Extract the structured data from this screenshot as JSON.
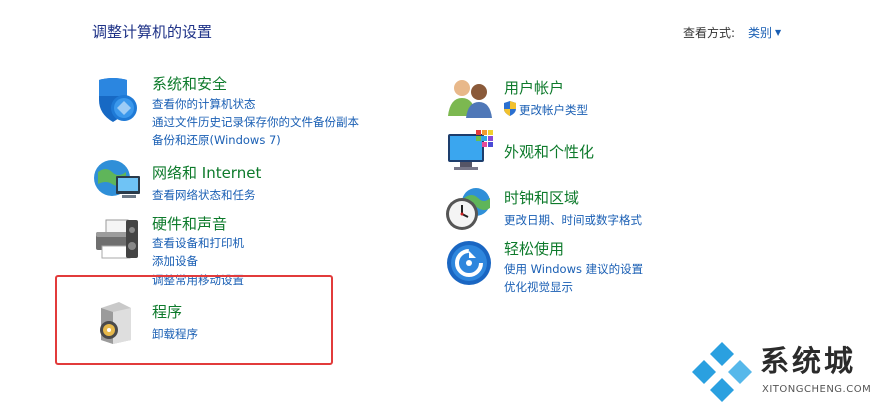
{
  "header": {
    "title": "调整计算机的设置",
    "view_by_label": "查看方式:",
    "view_by_value": "类别"
  },
  "categories": {
    "system_security": {
      "icon": "shield-icon",
      "title": "系统和安全",
      "links": [
        "查看你的计算机状态",
        "通过文件历史记录保存你的文件备份副本",
        "备份和还原(Windows 7)"
      ]
    },
    "network": {
      "icon": "network-globe-icon",
      "title": "网络和 Internet",
      "links": [
        "查看网络状态和任务"
      ]
    },
    "hardware": {
      "icon": "printer-icon",
      "title": "硬件和声音",
      "links": [
        "查看设备和打印机",
        "添加设备",
        "调整常用移动设置"
      ]
    },
    "programs": {
      "icon": "programs-disc-icon",
      "title": "程序",
      "links": [
        "卸载程序"
      ]
    },
    "user_accounts": {
      "icon": "users-icon",
      "title": "用户帐户",
      "links": [
        "更改帐户类型"
      ]
    },
    "appearance": {
      "icon": "monitor-palette-icon",
      "title": "外观和个性化",
      "links": []
    },
    "clock_region": {
      "icon": "clock-globe-icon",
      "title": "时钟和区域",
      "links": [
        "更改日期、时间或数字格式"
      ]
    },
    "ease_of_access": {
      "icon": "ease-of-access-icon",
      "title": "轻松使用",
      "links": [
        "使用 Windows 建议的设置",
        "优化视觉显示"
      ]
    }
  },
  "watermark": {
    "text": "系统城",
    "url": "XITONGCHENG.COM"
  },
  "colors": {
    "title_blue": "#1e3287",
    "link_blue": "#1a5fb4",
    "category_green": "#0d7a2b",
    "highlight_red": "#e23b3b"
  }
}
